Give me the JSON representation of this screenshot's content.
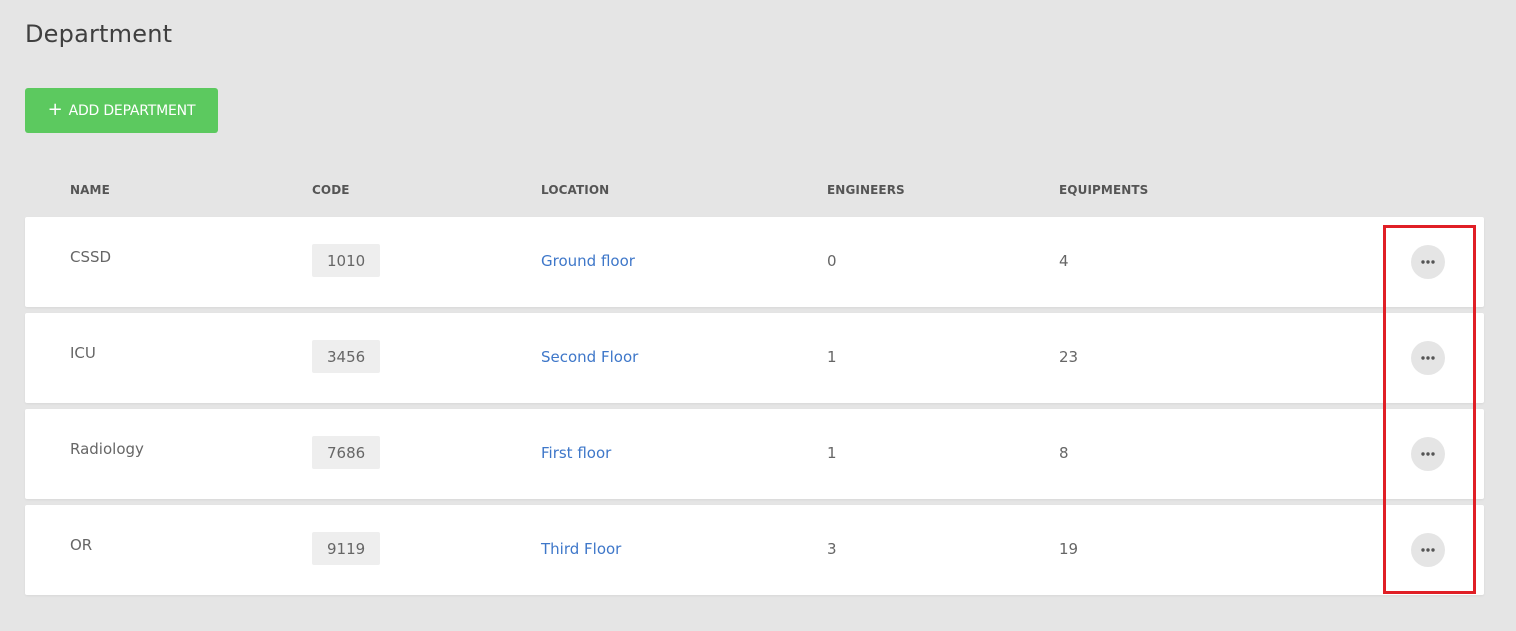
{
  "page": {
    "title": "Department"
  },
  "actions": {
    "add_label": "ADD DEPARTMENT",
    "add_plus": "+"
  },
  "table": {
    "columns": {
      "name": "NAME",
      "code": "CODE",
      "location": "LOCATION",
      "engineers": "ENGINEERS",
      "equipments": "EQUIPMENTS"
    },
    "rows": [
      {
        "name": "CSSD",
        "code": "1010",
        "location": "Ground floor",
        "engineers": "0",
        "equipments": "4"
      },
      {
        "name": "ICU",
        "code": "3456",
        "location": "Second Floor",
        "engineers": "1",
        "equipments": "23"
      },
      {
        "name": "Radiology",
        "code": "7686",
        "location": "First floor",
        "engineers": "1",
        "equipments": "8"
      },
      {
        "name": "OR",
        "code": "9119",
        "location": "Third Floor",
        "engineers": "3",
        "equipments": "19"
      }
    ],
    "row_action_icon": "more-horizontal-icon"
  },
  "colors": {
    "background": "#e5e5e5",
    "primary_button": "#5cc95f",
    "link": "#3e77c9",
    "highlight": "#e01f26"
  }
}
